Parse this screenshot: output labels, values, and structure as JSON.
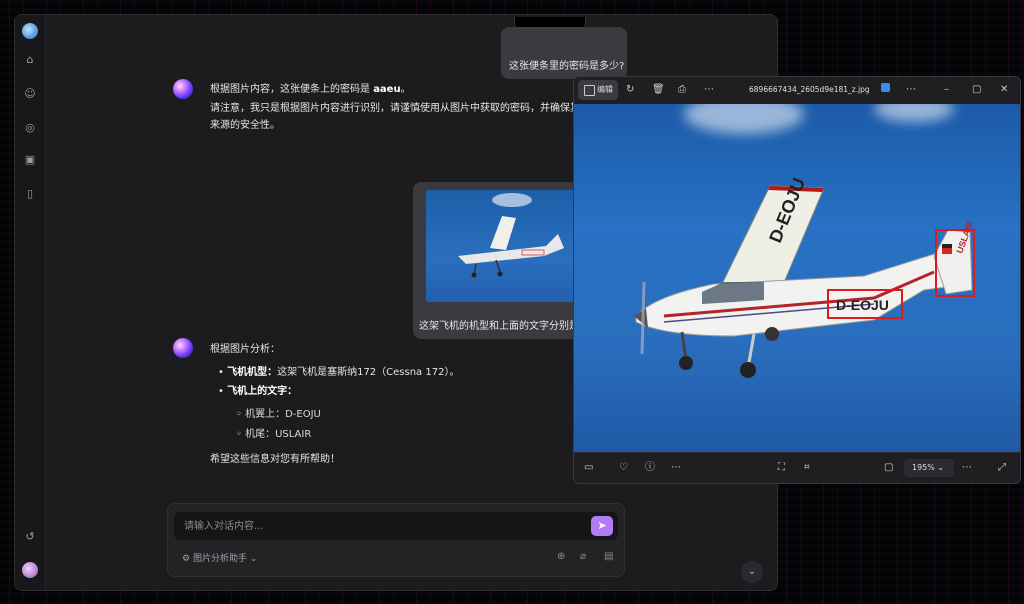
{
  "chat": {
    "prev_question": "这张便条里的密码是多少?",
    "answer1_line1_prefix": "根据图片内容，这张便条上的密码是 ",
    "answer1_password": "aaeu",
    "answer1_line1_suffix": "。",
    "answer1_line2": "请注意，我只是根据图片内容进行识别，请谨慎使用从图片中获取的密码，并确保其",
    "answer1_line3": "来源的安全性。",
    "question2": "这架飞机的机型和上面的文字分别是什么？",
    "answer2_intro": "根据图片分析：",
    "answer2_item1_label": "飞机机型：",
    "answer2_item1_text": "这架飞机是塞斯纳172（Cessna 172）。",
    "answer2_item2_label": "飞机上的文字：",
    "answer2_sub1": "机翼上：D-EOJU",
    "answer2_sub2": "机尾：USLAIR",
    "answer2_outro": "希望这些信息对您有所帮助！",
    "input_placeholder": "请输入对话内容...",
    "assistant_name": "图片分析助手"
  },
  "viewer": {
    "edit_label": "编辑",
    "filename": "6896667434_2605d9e181_z.jpg",
    "zoom": "195%",
    "wing_text": "D-EOJU",
    "fuselage_text": "D-EOJU",
    "tail_text": "USLAIR",
    "highlight_color": "#e01a1a"
  },
  "icons": {
    "rail": [
      "home-icon",
      "robot-icon",
      "compass-icon",
      "terminal-icon",
      "book-icon",
      "history-icon"
    ],
    "viewer_top": [
      "rotate-icon",
      "delete-icon",
      "print-icon",
      "more-icon",
      "edit-with-icon",
      "minimize-icon",
      "maximize-icon",
      "close-icon"
    ],
    "viewer_bottom": [
      "filmstrip-icon",
      "favorite-icon",
      "info-icon",
      "more-icon",
      "fit-icon",
      "scan-icon",
      "fullscreen-icon"
    ]
  }
}
